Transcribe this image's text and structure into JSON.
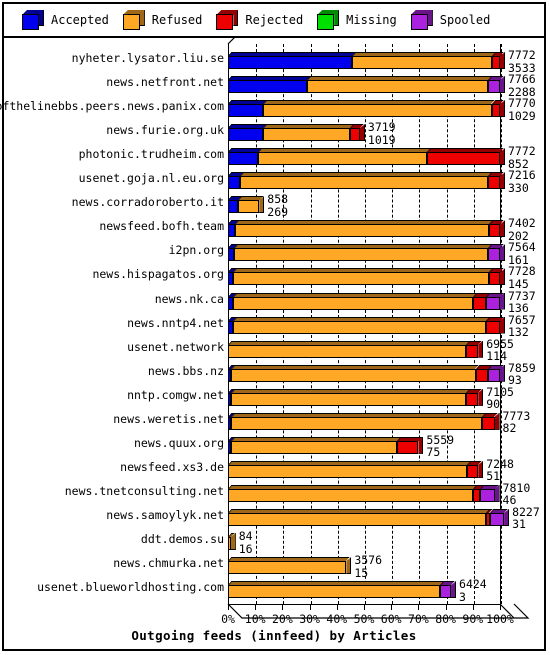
{
  "legend": {
    "items": [
      {
        "label": "Accepted",
        "color": "#0000ee",
        "icon": "cube-icon"
      },
      {
        "label": "Refused",
        "color": "#ffa826",
        "icon": "cube-icon"
      },
      {
        "label": "Rejected",
        "color": "#ee0000",
        "icon": "cube-icon"
      },
      {
        "label": "Missing",
        "color": "#00e000",
        "icon": "cube-icon"
      },
      {
        "label": "Spooled",
        "color": "#aa22dd",
        "icon": "cube-icon"
      }
    ]
  },
  "axis": {
    "xticks": [
      "0%",
      "10%",
      "20%",
      "30%",
      "40%",
      "50%",
      "60%",
      "70%",
      "80%",
      "90%",
      "100%"
    ],
    "title": "Outgoing feeds (innfeed) by Articles"
  },
  "chart_data": {
    "type": "bar",
    "orientation": "horizontal",
    "stacked": true,
    "title": "Outgoing feeds (innfeed) by Articles",
    "xlabel": "Outgoing feeds (innfeed) by Articles",
    "ylabel": "",
    "xlim": [
      0,
      100
    ],
    "xunit": "percent",
    "grid": true,
    "legend_position": "top",
    "series": [
      {
        "name": "Accepted",
        "color": "#0000ee"
      },
      {
        "name": "Refused",
        "color": "#ffa826"
      },
      {
        "name": "Rejected",
        "color": "#ee0000"
      },
      {
        "name": "Missing",
        "color": "#00e000"
      },
      {
        "name": "Spooled",
        "color": "#aa22dd"
      }
    ],
    "categories": [
      "nyheter.lysator.liu.se",
      "news.netfront.net",
      "endofthelinebbs.peers.news.panix.com",
      "news.furie.org.uk",
      "photonic.trudheim.com",
      "usenet.goja.nl.eu.org",
      "news.corradoroberto.it",
      "newsfeed.bofh.team",
      "i2pn.org",
      "news.hispagatos.org",
      "news.nk.ca",
      "news.nntp4.net",
      "usenet.network",
      "news.bbs.nz",
      "nntp.comgw.net",
      "news.weretis.net",
      "news.quux.org",
      "newsfeed.xs3.de",
      "news.tnetconsulting.net",
      "news.samoylyk.net",
      "ddt.demos.su",
      "news.chmurka.net",
      "usenet.blueworldhosting.com"
    ],
    "rows": [
      {
        "label": "nyheter.lysator.liu.se",
        "top": 7772,
        "bottom": 3533,
        "segments": [
          {
            "series": "Accepted",
            "pct": 45.5
          },
          {
            "series": "Refused",
            "pct": 51.5
          },
          {
            "series": "Rejected",
            "pct": 3.0
          }
        ]
      },
      {
        "label": "news.netfront.net",
        "top": 7766,
        "bottom": 2288,
        "segments": [
          {
            "series": "Accepted",
            "pct": 29.0
          },
          {
            "series": "Refused",
            "pct": 66.5
          },
          {
            "series": "Spooled",
            "pct": 4.5
          }
        ]
      },
      {
        "label": "endofthelinebbs.peers.news.panix.com",
        "top": 7770,
        "bottom": 1029,
        "segments": [
          {
            "series": "Accepted",
            "pct": 13.0
          },
          {
            "series": "Refused",
            "pct": 84.0
          },
          {
            "series": "Rejected",
            "pct": 3.0
          }
        ]
      },
      {
        "label": "news.furie.org.uk",
        "top": 3719,
        "bottom": 1019,
        "segments": [
          {
            "series": "Accepted",
            "pct": 13.0
          },
          {
            "series": "Refused",
            "pct": 32.0
          },
          {
            "series": "Rejected",
            "pct": 3.5
          }
        ]
      },
      {
        "label": "photonic.trudheim.com",
        "top": 7772,
        "bottom": 852,
        "segments": [
          {
            "series": "Accepted",
            "pct": 11.0
          },
          {
            "series": "Refused",
            "pct": 62.0
          },
          {
            "series": "Rejected",
            "pct": 27.0
          }
        ]
      },
      {
        "label": "usenet.goja.nl.eu.org",
        "top": 7216,
        "bottom": 330,
        "segments": [
          {
            "series": "Accepted",
            "pct": 4.5
          },
          {
            "series": "Refused",
            "pct": 91.0
          },
          {
            "series": "Rejected",
            "pct": 4.5
          }
        ]
      },
      {
        "label": "news.corradoroberto.it",
        "top": 858,
        "bottom": 269,
        "segments": [
          {
            "series": "Accepted",
            "pct": 3.5
          },
          {
            "series": "Refused",
            "pct": 8.0
          }
        ]
      },
      {
        "label": "newsfeed.bofh.team",
        "top": 7402,
        "bottom": 202,
        "segments": [
          {
            "series": "Accepted",
            "pct": 2.7
          },
          {
            "series": "Refused",
            "pct": 93.3
          },
          {
            "series": "Rejected",
            "pct": 4.0
          }
        ]
      },
      {
        "label": "i2pn.org",
        "top": 7564,
        "bottom": 161,
        "segments": [
          {
            "series": "Accepted",
            "pct": 2.1
          },
          {
            "series": "Refused",
            "pct": 93.4
          },
          {
            "series": "Spooled",
            "pct": 4.5
          }
        ]
      },
      {
        "label": "news.hispagatos.org",
        "top": 7728,
        "bottom": 145,
        "segments": [
          {
            "series": "Accepted",
            "pct": 1.9
          },
          {
            "series": "Refused",
            "pct": 94.1
          },
          {
            "series": "Rejected",
            "pct": 4.0
          }
        ]
      },
      {
        "label": "news.nk.ca",
        "top": 7737,
        "bottom": 136,
        "segments": [
          {
            "series": "Accepted",
            "pct": 1.8
          },
          {
            "series": "Refused",
            "pct": 88.2
          },
          {
            "series": "Rejected",
            "pct": 5.0
          },
          {
            "series": "Spooled",
            "pct": 5.0
          }
        ]
      },
      {
        "label": "news.nntp4.net",
        "top": 7657,
        "bottom": 132,
        "segments": [
          {
            "series": "Accepted",
            "pct": 1.7
          },
          {
            "series": "Refused",
            "pct": 93.3
          },
          {
            "series": "Rejected",
            "pct": 5.0
          }
        ]
      },
      {
        "label": "usenet.network",
        "top": 6955,
        "bottom": 114,
        "segments": [
          {
            "series": "Refused",
            "pct": 87.5
          },
          {
            "series": "Rejected",
            "pct": 4.5
          }
        ]
      },
      {
        "label": "news.bbs.nz",
        "top": 7859,
        "bottom": 93,
        "segments": [
          {
            "series": "Accepted",
            "pct": 1.2
          },
          {
            "series": "Refused",
            "pct": 89.8
          },
          {
            "series": "Rejected",
            "pct": 4.5
          },
          {
            "series": "Spooled",
            "pct": 4.5
          }
        ]
      },
      {
        "label": "nntp.comgw.net",
        "top": 7105,
        "bottom": 90,
        "segments": [
          {
            "series": "Accepted",
            "pct": 1.2
          },
          {
            "series": "Refused",
            "pct": 86.3
          },
          {
            "series": "Rejected",
            "pct": 4.5
          }
        ]
      },
      {
        "label": "news.weretis.net",
        "top": 7773,
        "bottom": 82,
        "segments": [
          {
            "series": "Accepted",
            "pct": 1.1
          },
          {
            "series": "Refused",
            "pct": 92.4
          },
          {
            "series": "Rejected",
            "pct": 4.5
          }
        ]
      },
      {
        "label": "news.quux.org",
        "top": 5559,
        "bottom": 75,
        "segments": [
          {
            "series": "Accepted",
            "pct": 1.0
          },
          {
            "series": "Refused",
            "pct": 61.0
          },
          {
            "series": "Rejected",
            "pct": 8.0
          }
        ]
      },
      {
        "label": "newsfeed.xs3.de",
        "top": 7248,
        "bottom": 51,
        "segments": [
          {
            "series": "Refused",
            "pct": 88.0
          },
          {
            "series": "Rejected",
            "pct": 4.0
          }
        ]
      },
      {
        "label": "news.tnetconsulting.net",
        "top": 7810,
        "bottom": 46,
        "segments": [
          {
            "series": "Refused",
            "pct": 90.0
          },
          {
            "series": "Rejected",
            "pct": 2.5
          },
          {
            "series": "Spooled",
            "pct": 5.5
          }
        ]
      },
      {
        "label": "news.samoylyk.net",
        "top": 8227,
        "bottom": 31,
        "segments": [
          {
            "series": "Refused",
            "pct": 95.0
          },
          {
            "series": "Rejected",
            "pct": 1.2
          },
          {
            "series": "Spooled",
            "pct": 5.3
          }
        ]
      },
      {
        "label": "ddt.demos.su",
        "top": 84,
        "bottom": 16,
        "segments": [
          {
            "series": "Refused",
            "pct": 1.0
          }
        ]
      },
      {
        "label": "news.chmurka.net",
        "top": 3576,
        "bottom": 15,
        "segments": [
          {
            "series": "Refused",
            "pct": 43.5
          }
        ]
      },
      {
        "label": "usenet.blueworldhosting.com",
        "top": 6424,
        "bottom": 3,
        "segments": [
          {
            "series": "Refused",
            "pct": 78.0
          },
          {
            "series": "Spooled",
            "pct": 4.0
          }
        ]
      }
    ]
  }
}
